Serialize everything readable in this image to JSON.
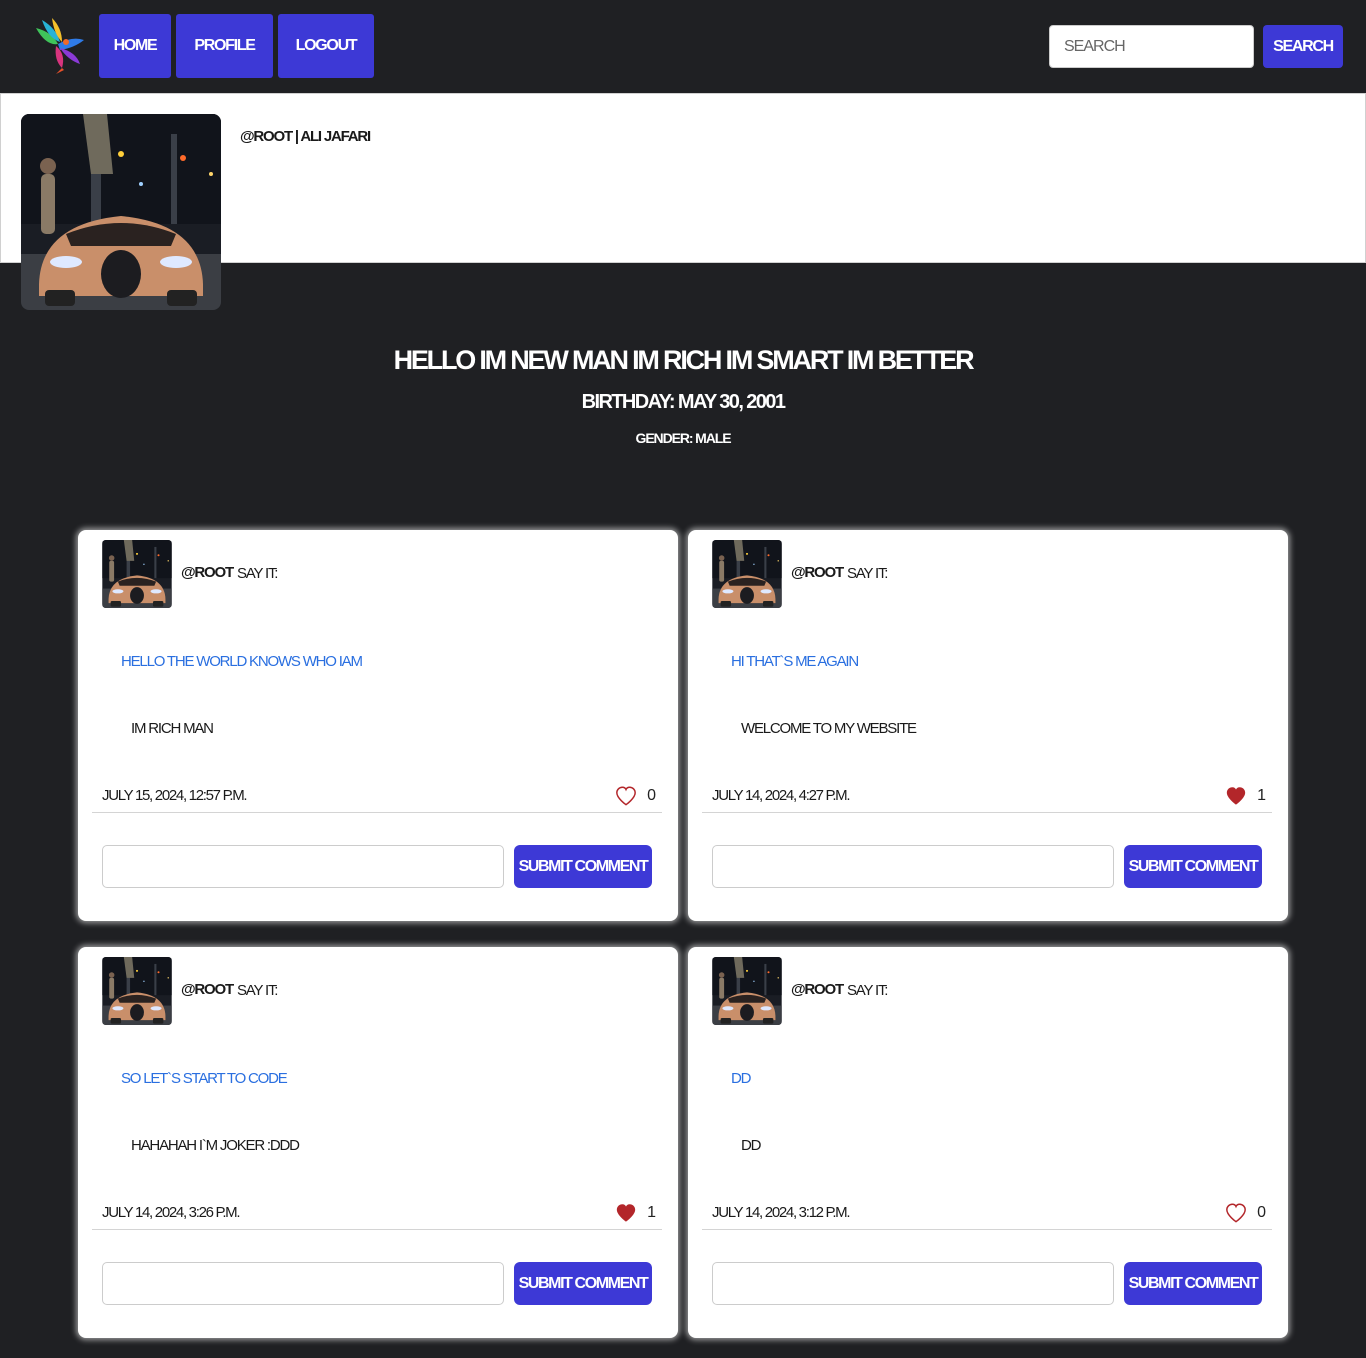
{
  "colors": {
    "background": "#1f2023",
    "accent": "#3d39d6",
    "link": "#2a6fe0",
    "liked": "#b3262a"
  },
  "nav": {
    "logo_icon": "hummingbird-logo-icon",
    "items": [
      {
        "label": "HOME"
      },
      {
        "label": "PROFILE"
      },
      {
        "label": "LOGOUT"
      }
    ],
    "search_placeholder": "SEARCH",
    "search_button": "SEARCH"
  },
  "profile": {
    "photo_icon": "car-photo",
    "handle": "@ROOT | ALI JAFARI",
    "bio": "HELLO IM NEW MAN IM RICH IM SMART IM BETTER",
    "birthday": "BIRTHDAY: MAY 30, 2001",
    "gender": "GENDER: MALE"
  },
  "posts": [
    {
      "handle": "@ROOT",
      "say": "SAY IT:",
      "title": "HELLO THE WORLD KNOWS WHO IAM",
      "body": "IM RICH MAN",
      "date": "JULY 15, 2024, 12:57 P.M.",
      "liked": false,
      "likes": "0",
      "comment_button": "SUBMIT COMMENT"
    },
    {
      "handle": "@ROOT",
      "say": "SAY IT:",
      "title": "HI THAT`S ME AGAIN",
      "body": "WELCOME TO MY WEBSITE",
      "date": "JULY 14, 2024, 4:27 P.M.",
      "liked": true,
      "likes": "1",
      "comment_button": "SUBMIT COMMENT"
    },
    {
      "handle": "@ROOT",
      "say": "SAY IT:",
      "title": "SO LET`S START TO CODE",
      "body": "HAHAHAH I`M JOKER :DDD",
      "date": "JULY 14, 2024, 3:26 P.M.",
      "liked": true,
      "likes": "1",
      "comment_button": "SUBMIT COMMENT"
    },
    {
      "handle": "@ROOT",
      "say": "SAY IT:",
      "title": "DD",
      "body": "DD",
      "date": "JULY 14, 2024, 3:12 P.M.",
      "liked": false,
      "likes": "0",
      "comment_button": "SUBMIT COMMENT"
    }
  ]
}
